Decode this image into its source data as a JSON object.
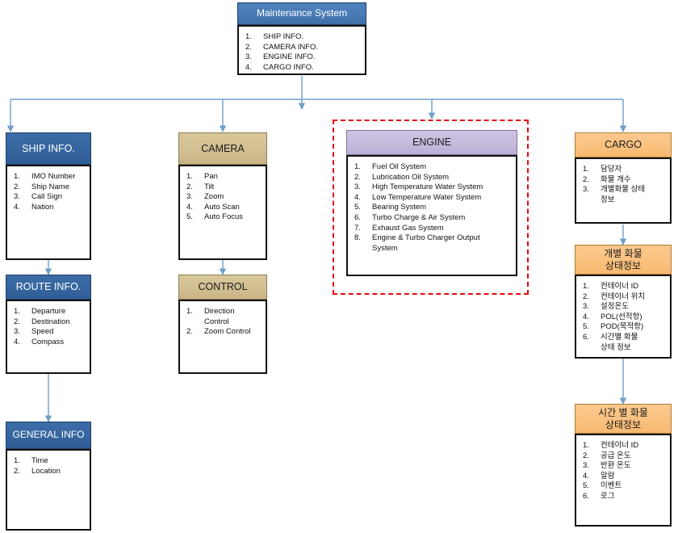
{
  "diagram": {
    "title": "Maintenance System hierarchy",
    "highlight_color": "#e8090b",
    "nodes": {
      "maintenance": {
        "header": "Maintenance System",
        "items": [
          "SHIP INFO.",
          "CAMERA INFO.",
          "ENGINE INFO.",
          "CARGO INFO."
        ]
      },
      "ship_info": {
        "header": "SHIP INFO.",
        "items": [
          "IMO Number",
          "Ship Name",
          "Call Sign",
          "Nation"
        ]
      },
      "route_info": {
        "header": "ROUTE INFO.",
        "items": [
          "Departure",
          "Destination",
          "Speed",
          "Compass"
        ]
      },
      "general_info": {
        "header": "GENERAL INFO",
        "items": [
          "Time",
          "Location"
        ]
      },
      "camera": {
        "header": "CAMERA",
        "items": [
          "Pan",
          "Tilt",
          "Zoom",
          "Auto Scan",
          "Auto Focus"
        ]
      },
      "control": {
        "header": "CONTROL",
        "items": [
          "Direction\nControl",
          "Zoom Control"
        ]
      },
      "engine": {
        "header": "ENGINE",
        "items": [
          "Fuel Oil System",
          "Lubrication Oil System",
          "High Temperature Water System",
          "Low Temperature Water System",
          "Bearing System",
          "Turbo Charge & Air System",
          "Exhaust Gas System",
          "Engine & Turbo Charger Output\nSystem"
        ]
      },
      "cargo": {
        "header": "CARGO",
        "items": [
          "담당자",
          "화물 개수",
          "개별화물 상태\n정보"
        ]
      },
      "cargo_detail": {
        "header": "개별 화물\n상태정보",
        "items": [
          "컨테이너 ID",
          "컨테이너 위치",
          "설정온도",
          "POL(선적항)",
          "POD(목적항)",
          "시간별 화물\n상태 정보"
        ]
      },
      "cargo_time": {
        "header": "시간 별 화물\n상태정보",
        "items": [
          "컨테이너 ID",
          "공급 온도",
          "반환 온도",
          "알람",
          "이벤트",
          "로그"
        ]
      }
    }
  }
}
